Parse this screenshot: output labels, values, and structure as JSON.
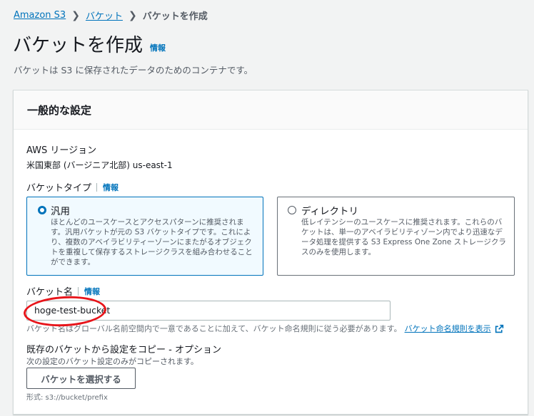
{
  "breadcrumb": {
    "root": "Amazon S3",
    "parent": "バケット",
    "current": "バケットを作成",
    "separator": "❯"
  },
  "page": {
    "title": "バケットを作成",
    "info": "情報",
    "description": "バケットは S3 に保存されたデータのためのコンテナです。"
  },
  "panel": {
    "title": "一般的な設定",
    "region": {
      "label": "AWS リージョン",
      "value": "米国東部 (バージニア北部) us-east-1"
    },
    "bucket_type": {
      "label": "バケットタイプ",
      "info": "情報",
      "options": [
        {
          "title": "汎用",
          "desc": "ほとんどのユースケースとアクセスパターンに推奨されます。汎用バケットが元の S3 バケットタイプです。これにより、複数のアベイラビリティーゾーンにまたがるオブジェクトを重複して保存するストレージクラスを組み合わせることができます。"
        },
        {
          "title": "ディレクトリ",
          "desc": "低レイテンシーのユースケースに推奨されます。これらのバケットは、単一のアベイラビリティゾーン内でより迅速なデータ処理を提供する S3 Express One Zone ストレージクラスのみを使用します。"
        }
      ]
    },
    "bucket_name": {
      "label": "バケット名",
      "info": "情報",
      "value": "hoge-test-bucket",
      "hint": "バケット名はグローバル名前空間内で一意であることに加えて、バケット命名規則に従う必要があります。",
      "hint_link": "バケット命名規則を表示"
    },
    "copy_settings": {
      "title": "既存のバケットから設定をコピー - オプション",
      "desc": "次の設定のバケット設定のみがコピーされます。",
      "button": "バケットを選択する",
      "format": "形式: s3://bucket/prefix"
    }
  },
  "colors": {
    "link": "#0073bb",
    "annotation": "#e8141a",
    "selected_bg": "#f1faff"
  }
}
